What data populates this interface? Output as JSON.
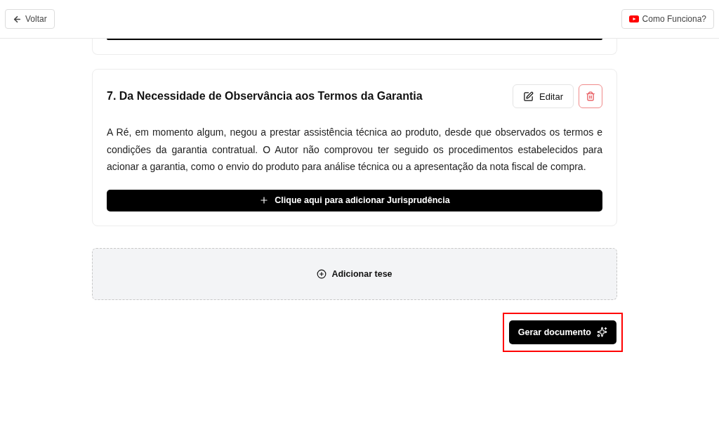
{
  "header": {
    "back_button": {
      "label": "Voltar"
    },
    "help_button": {
      "label": "Como Funciona?"
    }
  },
  "previous_card": {
    "kind": "partial"
  },
  "thesis_cards": [
    {
      "title": "7. Da Necessidade de Observância aos Termos da Garantia",
      "edit_label": "Editar",
      "body": "A Ré, em momento algum, negou a prestar assistência técnica ao produto, desde que observados os termos e condições da garantia contratual. O Autor não comprovou ter seguido os procedimentos estabelecidos para acionar a garantia, como o envio do produto para análise técnica ou a apresentação da nota fiscal de compra.",
      "add_jurisprudence_label": "Clique aqui para adicionar Jurisprudência"
    }
  ],
  "add_thesis": {
    "label": "Adicionar tese"
  },
  "generate_button": {
    "label": "Gerar documento",
    "highlighted": true
  }
}
